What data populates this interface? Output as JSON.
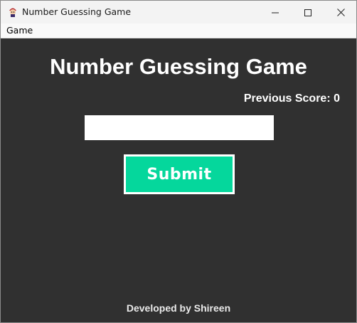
{
  "window": {
    "title": "Number Guessing Game",
    "app_icon": "character-icon",
    "controls": {
      "minimize_icon": "minimize-icon",
      "maximize_icon": "maximize-icon",
      "close_icon": "close-icon"
    }
  },
  "menubar": {
    "items": [
      {
        "label": "Game"
      }
    ]
  },
  "game": {
    "heading": "Number Guessing Game",
    "previous_score": "Previous Score: 0",
    "guess_input": {
      "value": "",
      "placeholder": ""
    },
    "submit_label": "Submit",
    "footer": "Developed by Shireen"
  },
  "colors": {
    "background": "#303030",
    "submit_button": "#05d79c",
    "submit_border": "#ffffff",
    "text": "#ffffff"
  }
}
